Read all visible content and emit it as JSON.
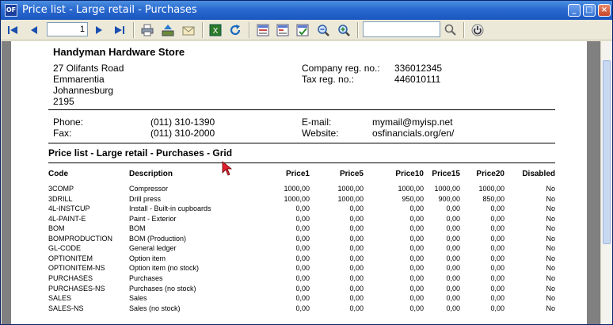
{
  "window": {
    "title": "Price list - Large retail - Purchases",
    "app_icon": "OF"
  },
  "toolbar": {
    "page_value": "1",
    "search_value": "",
    "icons": [
      "first-page-icon",
      "previous-page-icon",
      "next-page-icon",
      "last-page-icon",
      "print-icon",
      "export-icon",
      "email-icon",
      "excel-icon",
      "refresh-icon",
      "layout-1-icon",
      "layout-2-icon",
      "layout-3-icon",
      "zoom-out-icon",
      "zoom-in-icon",
      "search-icon",
      "close-preview-icon"
    ]
  },
  "report": {
    "company": "Handyman Hardware Store",
    "address": [
      "27 Olifants Road",
      "Emmarentia",
      "Johannesburg",
      "2195"
    ],
    "reg_labels": [
      "Company reg. no.:",
      "Tax reg. no.:"
    ],
    "reg_values": [
      "336012345",
      "446010111"
    ],
    "phone_label": "Phone:",
    "phone": "(011) 310-1390",
    "fax_label": "Fax:",
    "fax": "(011) 310-2000",
    "email_label": "E-mail:",
    "email": "mymail@myisp.net",
    "website_label": "Website:",
    "website": "osfinancials.org/en/",
    "title": "Price list - Large retail - Purchases - Grid",
    "columns": [
      "Code",
      "Description",
      "Price1",
      "Price5",
      "Price10",
      "Price15",
      "Price20",
      "Disabled"
    ],
    "rows": [
      [
        "3COMP",
        "Compressor",
        "1000,00",
        "1000,00",
        "1000,00",
        "1000,00",
        "1000,00",
        "No"
      ],
      [
        "3DRILL",
        "Drill press",
        "1000,00",
        "1000,00",
        "950,00",
        "900,00",
        "850,00",
        "No"
      ],
      [
        "4L-INSTCUP",
        "Install - Built-in cupboards",
        "0,00",
        "0,00",
        "0,00",
        "0,00",
        "0,00",
        "No"
      ],
      [
        "4L-PAINT-E",
        "Paint - Exterior",
        "0,00",
        "0,00",
        "0,00",
        "0,00",
        "0,00",
        "No"
      ],
      [
        "BOM",
        "BOM",
        "0,00",
        "0,00",
        "0,00",
        "0,00",
        "0,00",
        "No"
      ],
      [
        "BOMPRODUCTION",
        "BOM (Production)",
        "0,00",
        "0,00",
        "0,00",
        "0,00",
        "0,00",
        "No"
      ],
      [
        "GL-CODE",
        "General ledger",
        "0,00",
        "0,00",
        "0,00",
        "0,00",
        "0,00",
        "No"
      ],
      [
        "OPTIONITEM",
        "Option item",
        "0,00",
        "0,00",
        "0,00",
        "0,00",
        "0,00",
        "No"
      ],
      [
        "OPTIONITEM-NS",
        "Option item (no stock)",
        "0,00",
        "0,00",
        "0,00",
        "0,00",
        "0,00",
        "No"
      ],
      [
        "PURCHASES",
        "Purchases",
        "0,00",
        "0,00",
        "0,00",
        "0,00",
        "0,00",
        "No"
      ],
      [
        "PURCHASES-NS",
        "Purchases (no stock)",
        "0,00",
        "0,00",
        "0,00",
        "0,00",
        "0,00",
        "No"
      ],
      [
        "SALES",
        "Sales",
        "0,00",
        "0,00",
        "0,00",
        "0,00",
        "0,00",
        "No"
      ],
      [
        "SALES-NS",
        "Sales (no stock)",
        "0,00",
        "0,00",
        "0,00",
        "0,00",
        "0,00",
        "No"
      ]
    ]
  }
}
